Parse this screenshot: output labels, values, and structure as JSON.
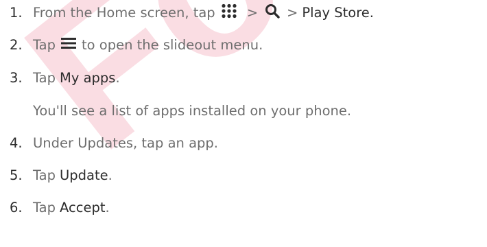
{
  "watermark": "For ce",
  "steps": [
    {
      "number": "1.",
      "part_from": "From the Home screen, tap",
      "sep1": ">",
      "sep2": ">",
      "target": "Play Store."
    },
    {
      "number": "2.",
      "part_tap": "Tap",
      "part_rest": "to open the slideout menu."
    },
    {
      "number": "3.",
      "part_tap": "Tap",
      "target": "My apps",
      "end": "."
    },
    {
      "number": "4.",
      "text": "Under Updates, tap an app."
    },
    {
      "number": "5.",
      "part_tap": "Tap",
      "target": "Update",
      "end": "."
    },
    {
      "number": "6.",
      "part_tap": "Tap",
      "target": "Accept",
      "end": "."
    }
  ],
  "note": "You'll see a list of apps installed on your phone.",
  "icons": {
    "apps": "apps-grid-icon",
    "search": "search-icon",
    "menu": "hamburger-menu-icon"
  }
}
